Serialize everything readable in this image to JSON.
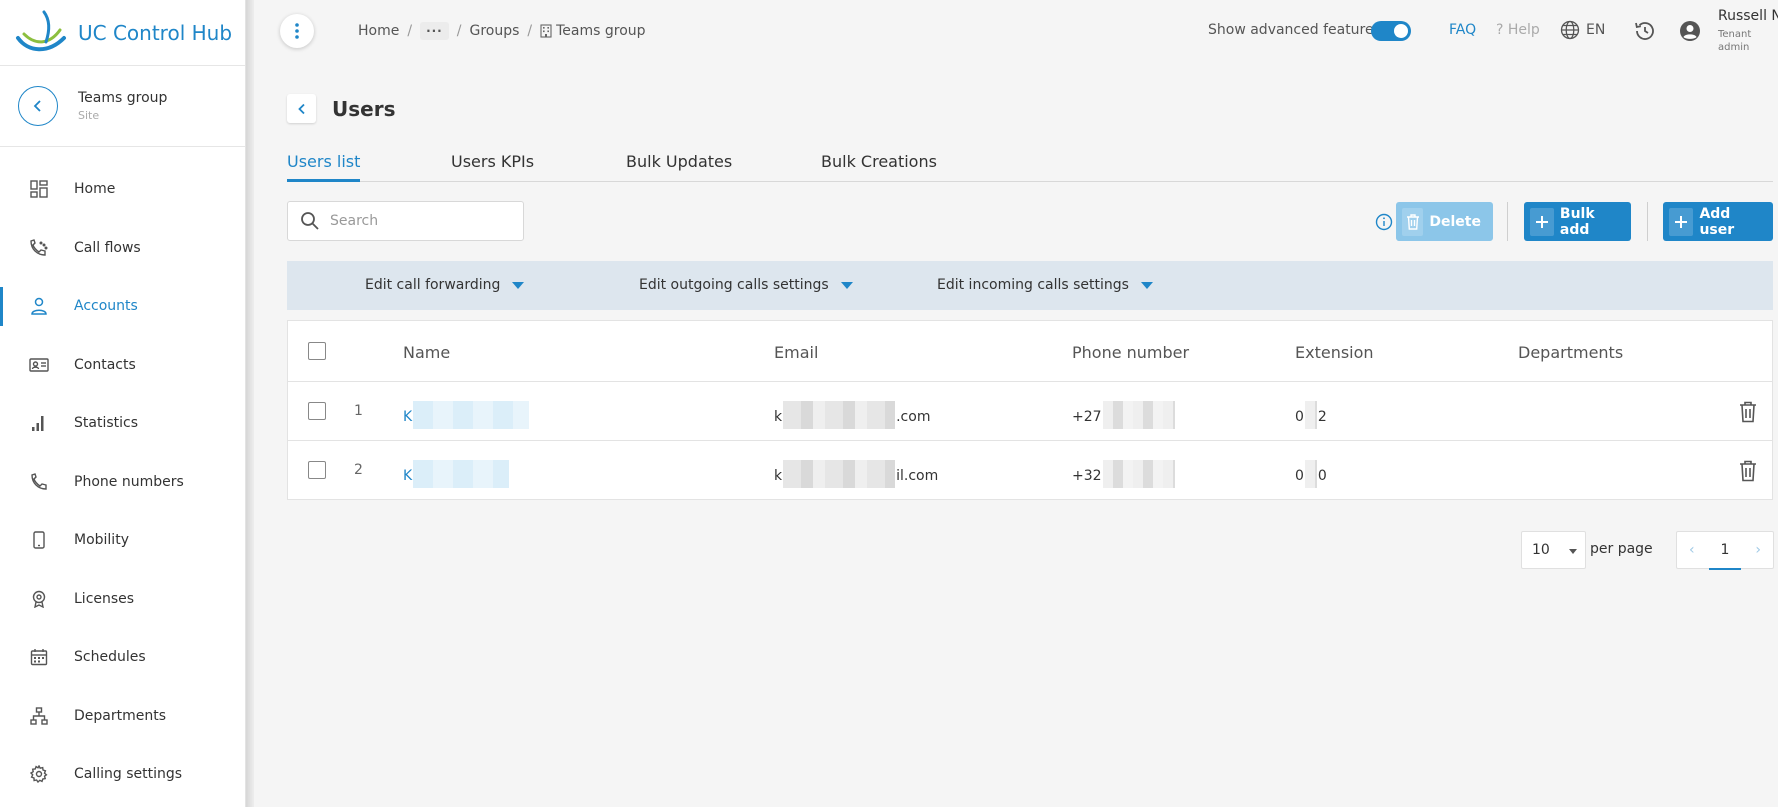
{
  "brand": {
    "name": "UC Control Hub"
  },
  "site": {
    "name": "Teams group",
    "type": "Site"
  },
  "sidebar": {
    "items": [
      {
        "label": "Home",
        "icon": "dashboard-icon"
      },
      {
        "label": "Call flows",
        "icon": "call-flow-icon"
      },
      {
        "label": "Accounts",
        "icon": "user-icon",
        "active": true
      },
      {
        "label": "Contacts",
        "icon": "contact-card-icon"
      },
      {
        "label": "Statistics",
        "icon": "bar-chart-icon"
      },
      {
        "label": "Phone numbers",
        "icon": "phone-icon"
      },
      {
        "label": "Mobility",
        "icon": "mobile-icon"
      },
      {
        "label": "Licenses",
        "icon": "license-icon"
      },
      {
        "label": "Schedules",
        "icon": "calendar-icon"
      },
      {
        "label": "Departments",
        "icon": "org-chart-icon"
      },
      {
        "label": "Calling settings",
        "icon": "gear-icon"
      }
    ]
  },
  "breadcrumb": {
    "home": "Home",
    "more": "···",
    "groups": "Groups",
    "current": "Teams group"
  },
  "topbar": {
    "advanced_label": "Show advanced features",
    "advanced_on": true,
    "faq": "FAQ",
    "help": "? Help",
    "lang": "EN",
    "user_name": "Russell N.",
    "user_role": "Tenant admin"
  },
  "page": {
    "title": "Users"
  },
  "tabs": [
    "Users list",
    "Users KPIs",
    "Bulk Updates",
    "Bulk Creations"
  ],
  "toolbar": {
    "search_placeholder": "Search",
    "delete_label": "Delete",
    "bulk_add_label": "Bulk add",
    "add_user_label": "Add user"
  },
  "edit_bar": {
    "call_forwarding": "Edit call forwarding",
    "outgoing": "Edit outgoing calls settings",
    "incoming": "Edit incoming calls settings"
  },
  "table": {
    "columns": [
      "Name",
      "Email",
      "Phone number",
      "Extension",
      "Departments"
    ],
    "rows": [
      {
        "index": "1",
        "name_start": "K",
        "email_start": "k",
        "email_end": ".com",
        "phone_start": "+27",
        "ext_start": "0",
        "ext_end": "2"
      },
      {
        "index": "2",
        "name_start": "K",
        "email_start": "k",
        "email_end": "il.com",
        "phone_start": "+32",
        "ext_start": "0",
        "ext_end": "0"
      }
    ]
  },
  "pagination": {
    "page_size": "10",
    "per_page_label": "per page",
    "current_page": "1"
  },
  "colors": {
    "accent": "#1f86c8",
    "accent_light": "#8cc6e9",
    "edit_bar": "#dde6ee"
  }
}
